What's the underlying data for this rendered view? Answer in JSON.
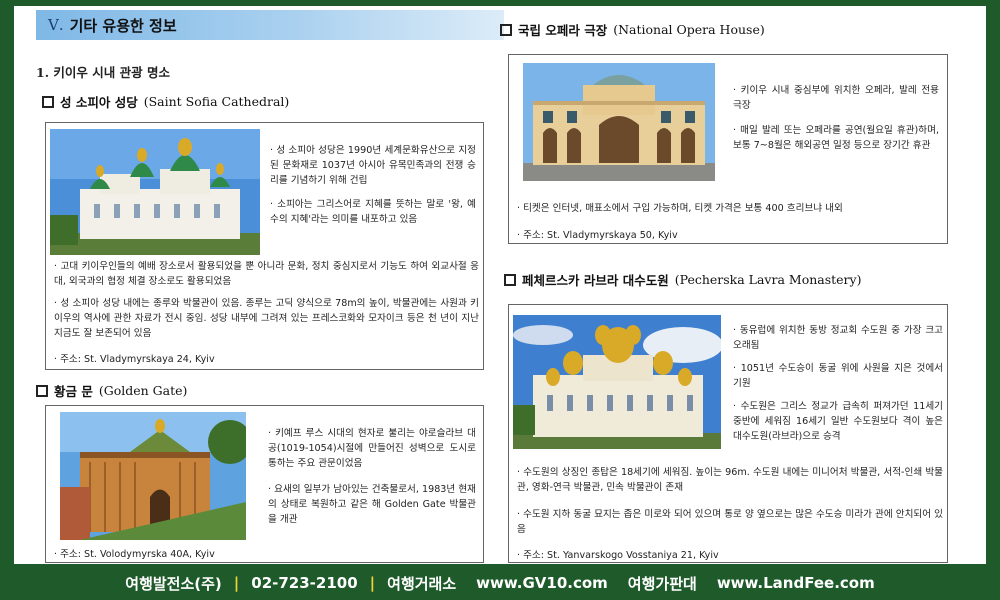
{
  "section": {
    "num": "Ⅴ.",
    "title": "기타 유용한 정보"
  },
  "subhead": "1. 키이우 시내 관광 명소",
  "places": {
    "sofia": {
      "ko": "성 소피아 성당",
      "en": "(Saint Sofia Cathedral)",
      "bullets": [
        "성 소피아 성당은 1990년 세계문화유산으로 지정된 문화재로 1037년 아시아 유목민족과의 전쟁 승리를 기념하기 위해 건립",
        "소피아는 그리스어로 지혜를 뜻하는 말로 '왕, 예수의 지혜'라는 의미를 내포하고 있음",
        "고대 키이우인들의 예배 장소로서 활용되었을 뿐 아니라 문화, 정치 중심지로서 기능도 하여 외교사절 응대, 외국과의 협정 체결 장소로도 활용되었음",
        "성 소피아 성당 내에는 종루와 박물관이 있음. 종루는 고딕 양식으로 78m의 높이, 박물관에는 사원과 키이우의 역사에 관한 자료가 전시 중임. 성당 내부에 그려져 있는 프레스코화와 모자이크 등은 천 년이 지난 지금도 잘 보존되어 있음"
      ],
      "address": "주소: St. Vladymyrskaya 24, Kyiv"
    },
    "gate": {
      "ko": "황금 문",
      "en": "(Golden Gate)",
      "bullets": [
        "키예프 루스 시대의 현자로 불리는 야로슬라브 대공(1019-1054)시절에 만들어진 성벽으로 도시로 통하는 주요 관문이었음",
        "요새의 일부가 남아있는 건축물로서, 1983년 현재의 상태로 복원하고 같은 해 Golden Gate 박물관을 개관"
      ],
      "address": "주소: St. Volodymyrska 40A, Kyiv"
    },
    "opera": {
      "ko": "국립 오페라 극장",
      "en": "(National Opera House)",
      "bullets": [
        "키이우 시내 중심부에 위치한 오페라, 발레 전용 극장",
        "매일 발레 또는 오페라를 공연(월요일 휴관)하며, 보통 7~8월은 해외공연 일정 등으로 장기간 휴관",
        "티켓은 인터넷, 매표소에서 구입 가능하며, 티켓 가격은 보통 400 흐리브냐 내외"
      ],
      "address": "주소: St. Vladymyrskaya 50, Kyiv"
    },
    "lavra": {
      "ko": "페체르스카 라브라 대수도원",
      "en": "(Pecherska Lavra Monastery)",
      "bullets": [
        "동유럽에 위치한 동방 정교회 수도원 중 가장 크고 오래됨",
        "1051년 수도승이 동굴 위에 사원을 지은 것에서 기원",
        "수도원은 그리스 정교가 급속히 퍼져가던 11세기 중반에 세워짐 16세기 일반 수도원보다 격이 높은 대수도원(라브라)으로 승격",
        "수도원의 상징인 종탑은 18세기에 세워짐. 높이는 96m. 수도원 내에는 미니어처 박물관, 서적-인쇄 박물관, 영화-연극 박물관, 민속 박물관이 존재",
        "수도원 지하 동굴 묘지는 좁은 미로와 되어 있으며 통로 양 옆으로는 많은 수도승 미라가 관에 안치되어 있음"
      ],
      "address": "주소: St. Yanvarskogo Vosstaniya 21, Kyiv"
    }
  },
  "footer": {
    "company": "여행발전소(주)",
    "phone": "02-723-2100",
    "label1": "여행거래소",
    "site1": "www.GV10.com",
    "label2": "여행가판대",
    "site2": "www.LandFee.com"
  },
  "colors": {
    "frame": "#1e5a2a",
    "header_band": "#7fb8e6",
    "footer_separator": "#f3d23a"
  }
}
